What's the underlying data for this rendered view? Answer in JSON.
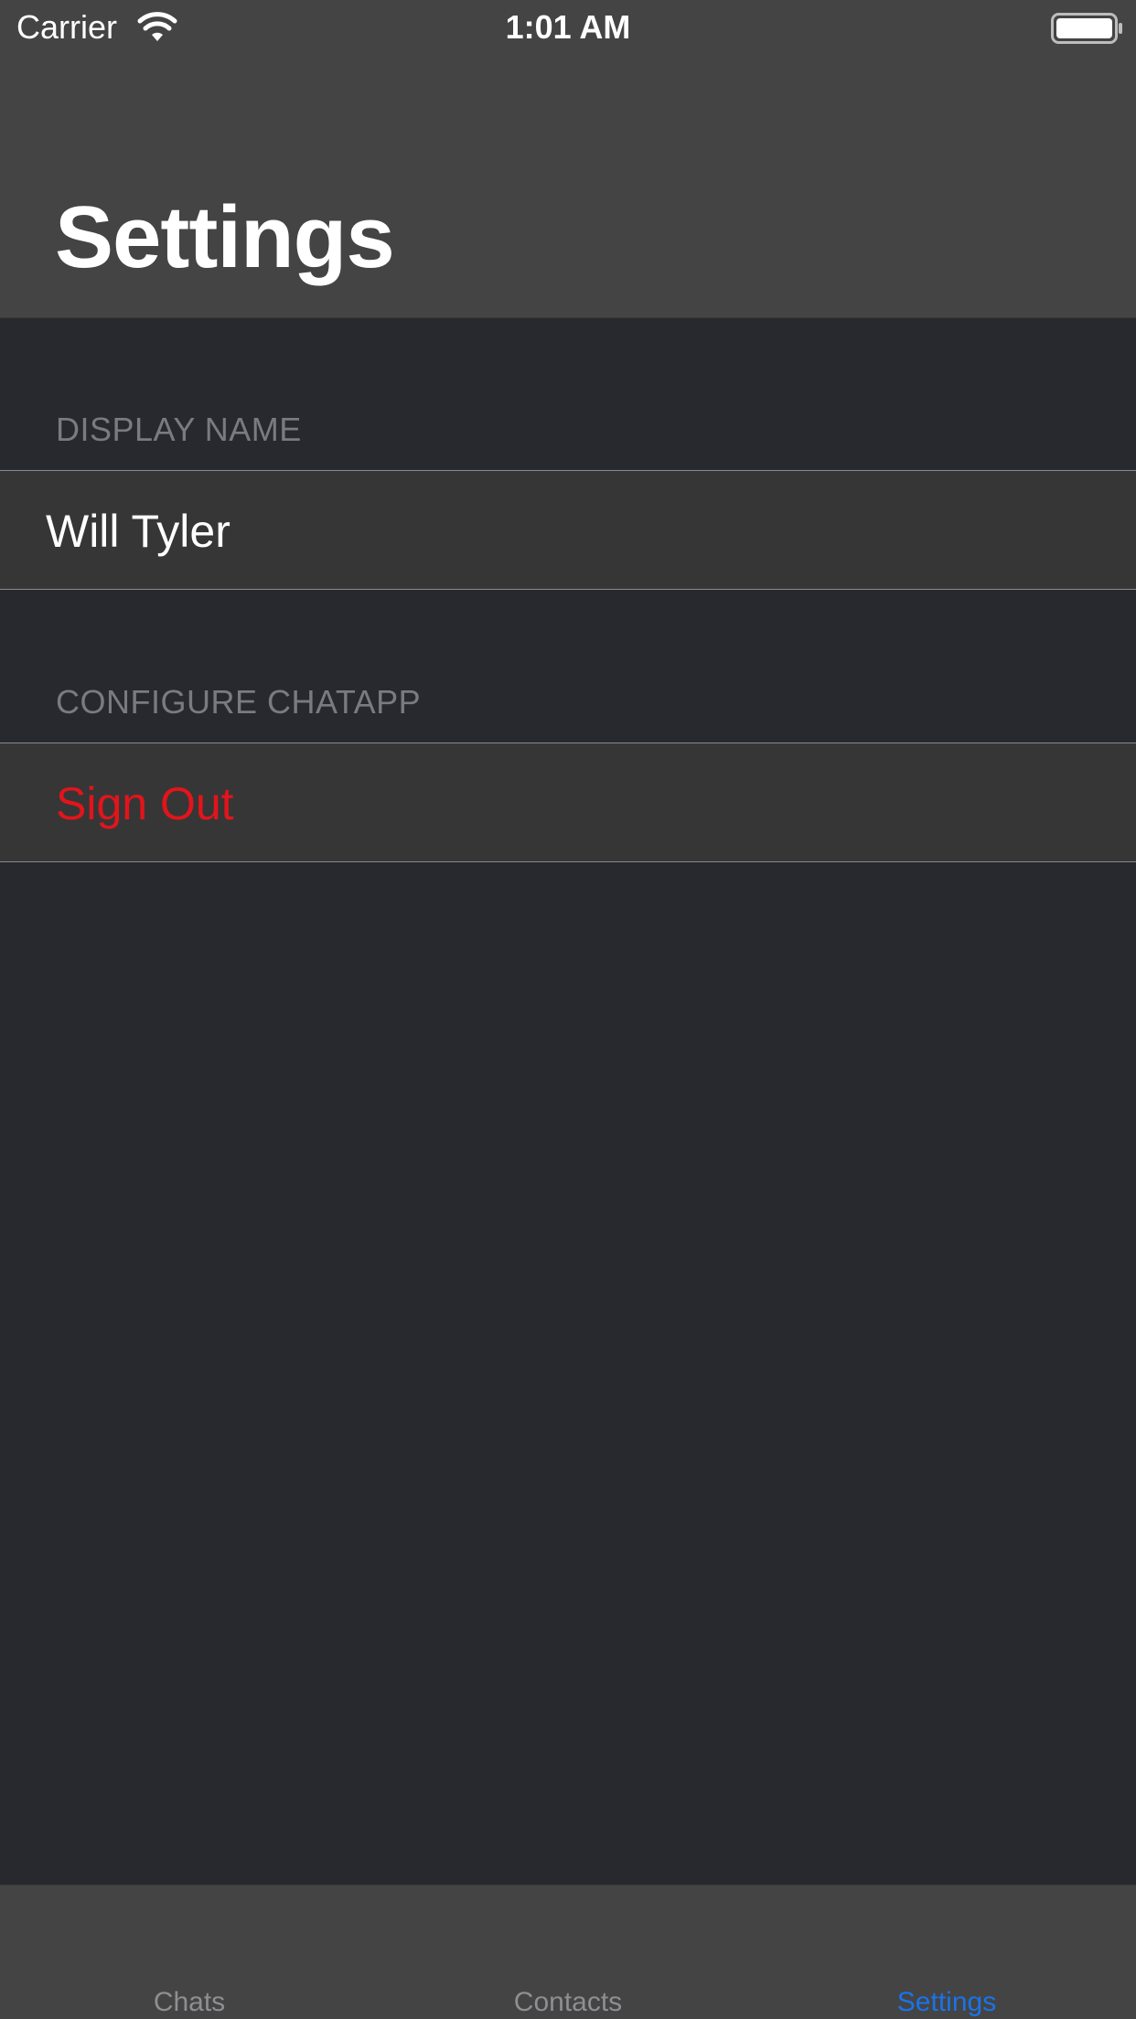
{
  "status_bar": {
    "carrier": "Carrier",
    "time": "1:01 AM",
    "wifi_icon": "wifi-icon",
    "battery_icon": "battery-full-icon"
  },
  "nav": {
    "title": "Settings"
  },
  "sections": {
    "display_name": {
      "header": "DISPLAY NAME",
      "value": "Will Tyler"
    },
    "configure": {
      "header": "CONFIGURE CHATAPP",
      "sign_out_label": "Sign Out"
    }
  },
  "tab_bar": {
    "tabs": [
      {
        "label": "Chats",
        "selected": false
      },
      {
        "label": "Contacts",
        "selected": false
      },
      {
        "label": "Settings",
        "selected": true
      }
    ]
  },
  "colors": {
    "accent": "#1a73e8",
    "destructive": "#e3141b",
    "tab_inactive": "#8e8e93",
    "background": "#28292e",
    "bar": "#444444",
    "cell": "#363636"
  }
}
